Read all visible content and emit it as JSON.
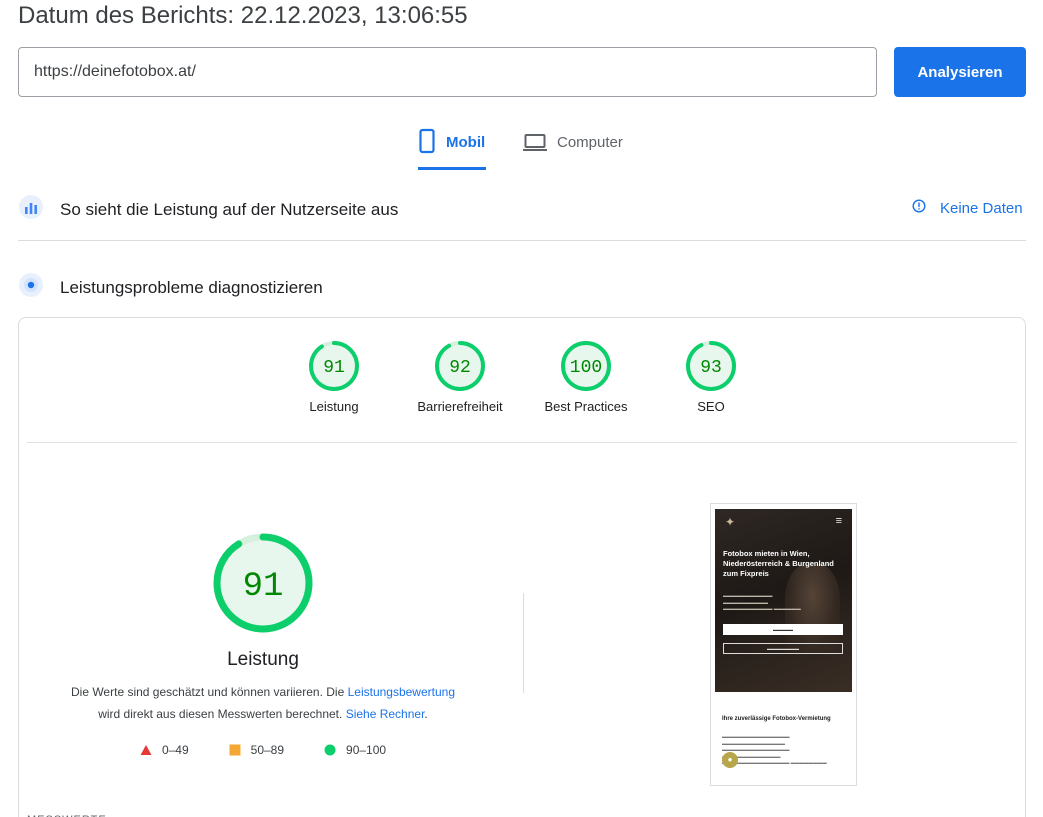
{
  "header": {
    "report_date": "Datum des Berichts: 22.12.2023, 13:06:55",
    "url_value": "https://deinefotobox.at/",
    "analyze_label": "Analysieren"
  },
  "tabs": [
    {
      "label": "Mobil",
      "active": true
    },
    {
      "label": "Computer",
      "active": false
    }
  ],
  "field_data": {
    "title": "So sieht die Leistung auf der Nutzerseite aus",
    "status": "Keine Daten"
  },
  "lab_data": {
    "title": "Leistungsprobleme diagnostizieren"
  },
  "scores": [
    {
      "label": "Leistung",
      "value": "91"
    },
    {
      "label": "Barrierefreiheit",
      "value": "92"
    },
    {
      "label": "Best Practices",
      "value": "100"
    },
    {
      "label": "SEO",
      "value": "93"
    }
  ],
  "main_score": {
    "value": "91",
    "title": "Leistung",
    "desc_1": "Die Werte sind geschätzt und können variieren. Die",
    "link_1": "Leistungsbewertung",
    "desc_2": "wird direkt aus diesen Messwerten berechnet.",
    "link_2": "Siehe Rechner",
    "desc_end": "."
  },
  "legend": [
    {
      "range": "0–49",
      "shape": "triangle",
      "color": "#e53935"
    },
    {
      "range": "50–89",
      "shape": "square",
      "color": "#f4a833"
    },
    {
      "range": "90–100",
      "shape": "circle",
      "color": "#0cce6b"
    }
  ],
  "colors": {
    "accent": "#1a73e8",
    "pass_ring": "#0cce6b",
    "pass_fill": "#e8f7ee",
    "pass_text": "#008800"
  },
  "screenshot": {
    "headline": "Fotobox mieten in Wien, Niederösterreich & Burgenland zum Fixpreis",
    "subheading": "Ihre zuverlässige Fotobox-Vermietung"
  }
}
